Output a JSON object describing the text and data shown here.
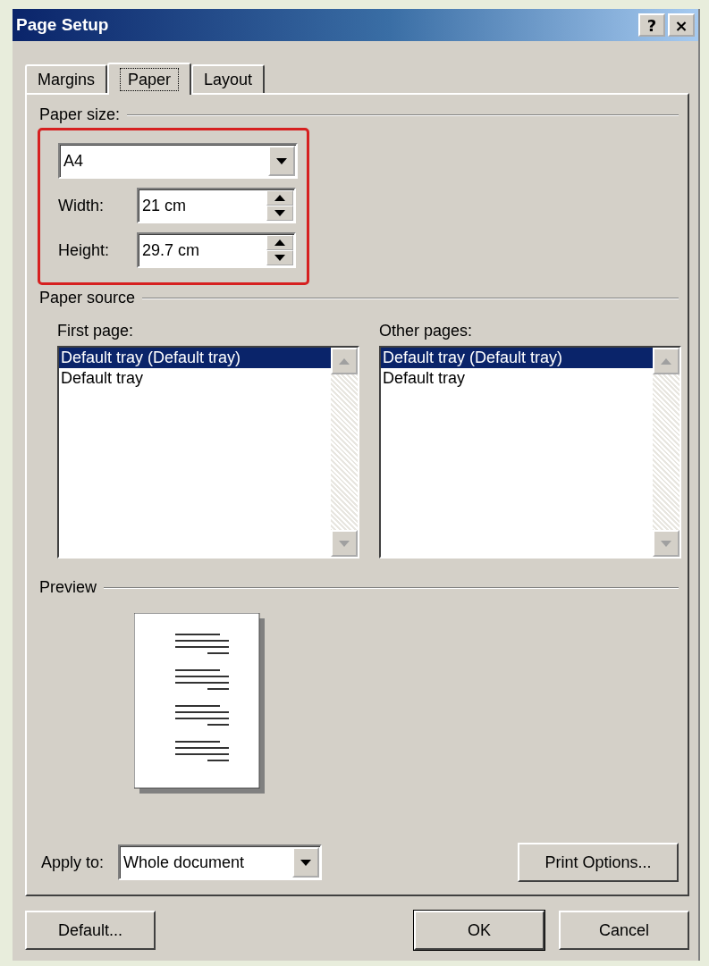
{
  "window": {
    "title": "Page Setup",
    "help_button": "?",
    "close_button": "×"
  },
  "tabs": [
    {
      "label": "Margins",
      "selected": false
    },
    {
      "label": "Paper",
      "selected": true
    },
    {
      "label": "Layout",
      "selected": false
    }
  ],
  "paper_size": {
    "label": "Paper size:",
    "highlighted": true,
    "value": "A4",
    "width": {
      "label": "Width:",
      "value": "21 cm"
    },
    "height": {
      "label": "Height:",
      "value": "29.7 cm"
    }
  },
  "paper_source": {
    "label": "Paper source",
    "lists": [
      {
        "label": "First page:",
        "items": [
          {
            "label": "Default tray (Default tray)",
            "selected": true
          },
          {
            "label": "Default tray",
            "selected": false
          }
        ]
      },
      {
        "label": "Other pages:",
        "items": [
          {
            "label": "Default tray (Default tray)",
            "selected": true
          },
          {
            "label": "Default tray",
            "selected": false
          }
        ]
      }
    ]
  },
  "preview": {
    "label": "Preview"
  },
  "apply_to": {
    "label": "Apply to:",
    "value": "Whole document"
  },
  "print_options": "Print Options...",
  "buttons": [
    {
      "label": "Default...",
      "kind": "left",
      "default": false
    },
    {
      "label": "OK",
      "kind": "right",
      "default": true
    },
    {
      "label": "Cancel",
      "kind": "right",
      "default": false
    }
  ]
}
